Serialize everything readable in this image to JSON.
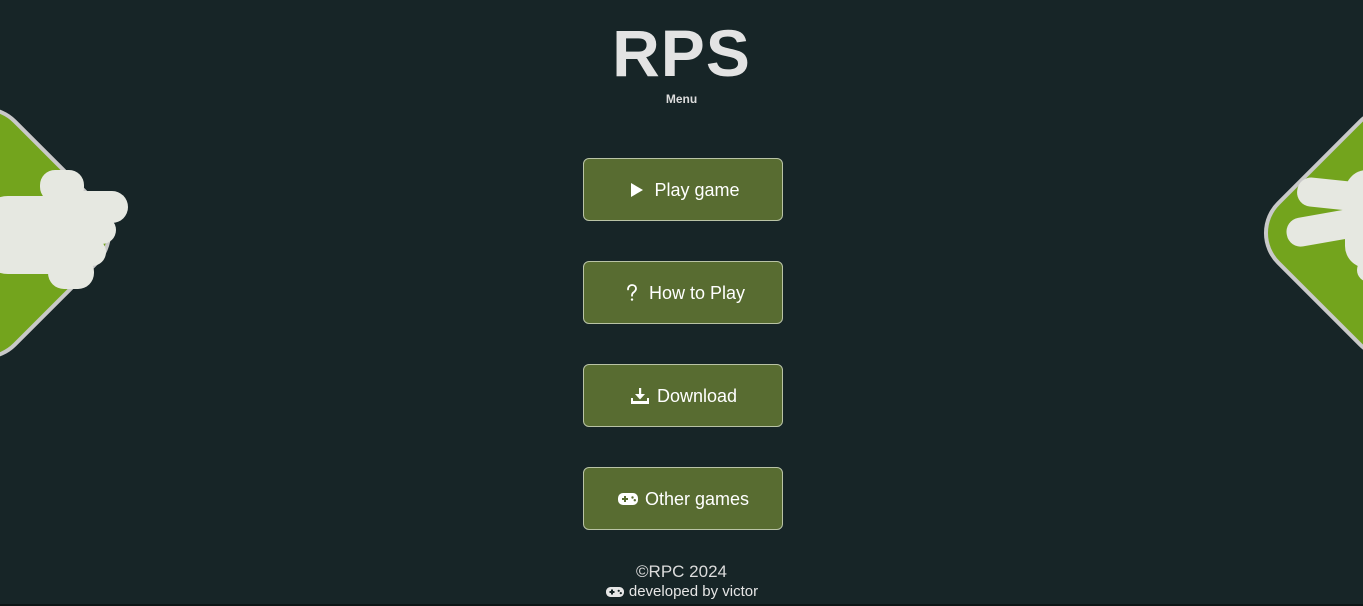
{
  "header": {
    "title": "RPS",
    "subtitle": "Menu"
  },
  "menu": {
    "items": [
      {
        "label": "Play game",
        "icon": "play-icon"
      },
      {
        "label": "How to Play",
        "icon": "question-icon"
      },
      {
        "label": "Download",
        "icon": "download-icon"
      },
      {
        "label": "Other games",
        "icon": "gamepad-icon"
      }
    ]
  },
  "footer": {
    "copyright": "©RPC 2024",
    "developer": "developed by victor",
    "developer_icon": "gamepad-icon"
  },
  "art": {
    "left": "rock-hand-icon",
    "right": "scissors-hand-icon"
  },
  "colors": {
    "background": "#172527",
    "button_fill": "#586c31",
    "button_border": "#b9c3a5",
    "hand_panel": "#73a41d",
    "hand_panel_border": "#c9c9c9",
    "hand_fill": "#e6e8e1"
  }
}
